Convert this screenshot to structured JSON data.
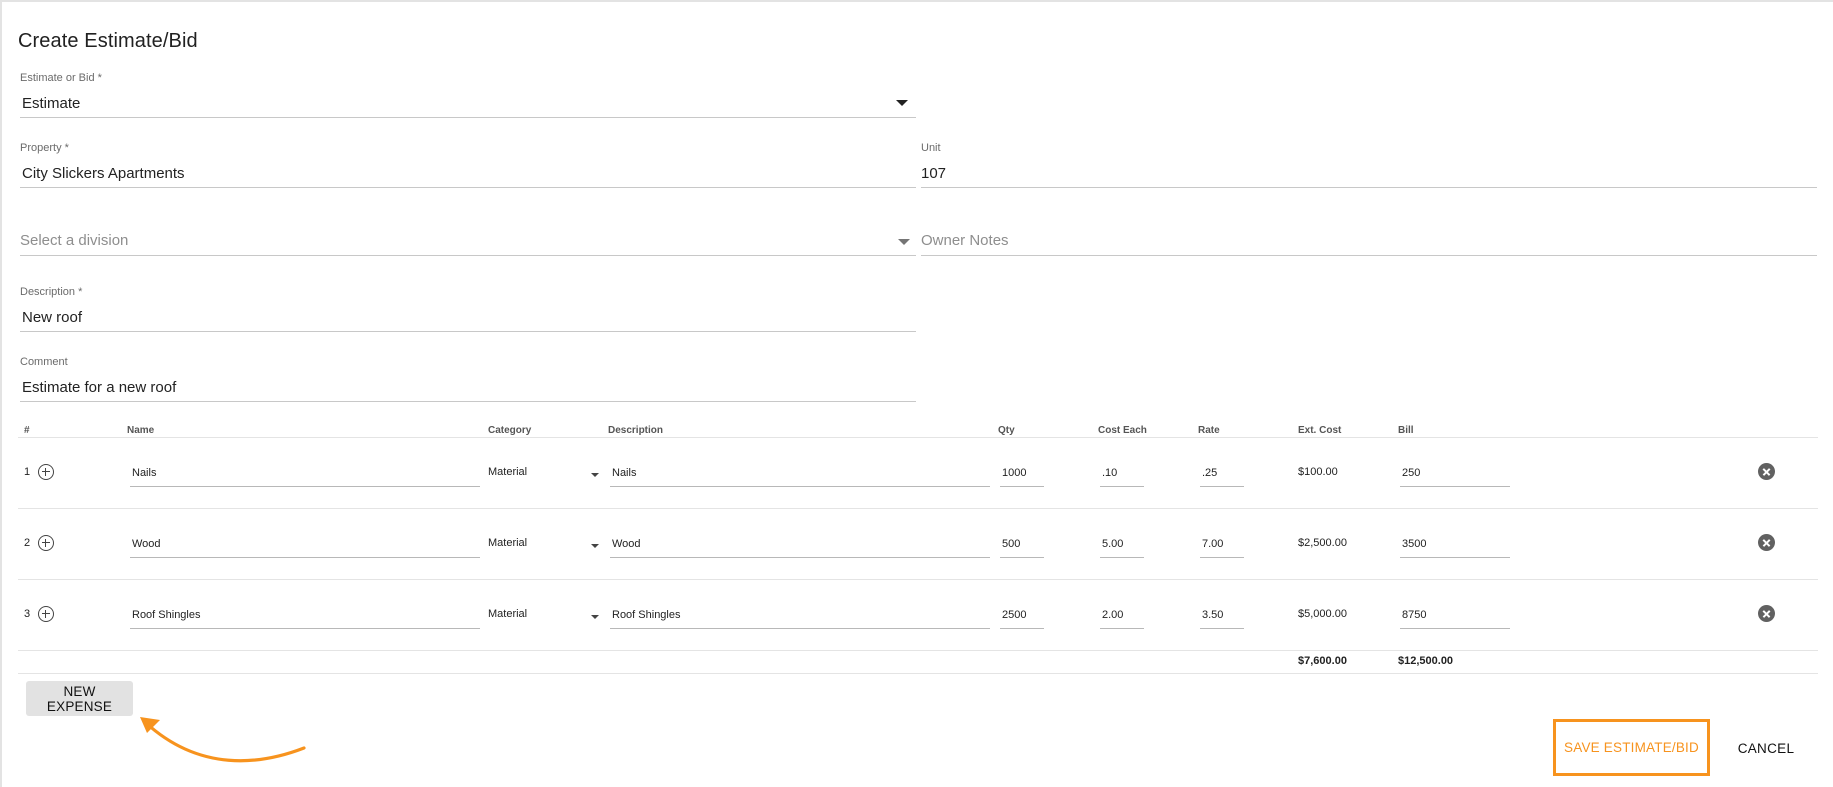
{
  "page": {
    "title": "Create Estimate/Bid"
  },
  "form": {
    "estimate_or_bid": {
      "label": "Estimate or Bid *",
      "value": "Estimate"
    },
    "property": {
      "label": "Property *",
      "value": "City Slickers Apartments"
    },
    "unit": {
      "label": "Unit",
      "value": "107"
    },
    "division": {
      "placeholder": "Select a division"
    },
    "owner_notes": {
      "placeholder": "Owner Notes"
    },
    "description": {
      "label": "Description *",
      "value": "New roof"
    },
    "comment": {
      "label": "Comment",
      "value": "Estimate for a new roof"
    }
  },
  "table": {
    "headers": {
      "num": "#",
      "name": "Name",
      "category": "Category",
      "description": "Description",
      "qty": "Qty",
      "cost_each": "Cost Each",
      "rate": "Rate",
      "ext_cost": "Ext. Cost",
      "bill": "Bill"
    },
    "rows": [
      {
        "num": "1",
        "name": "Nails",
        "category": "Material",
        "description": "Nails",
        "qty": "1000",
        "cost_each": ".10",
        "rate": ".25",
        "ext_cost": "$100.00",
        "bill": "250"
      },
      {
        "num": "2",
        "name": "Wood",
        "category": "Material",
        "description": "Wood",
        "qty": "500",
        "cost_each": "5.00",
        "rate": "7.00",
        "ext_cost": "$2,500.00",
        "bill": "3500"
      },
      {
        "num": "3",
        "name": "Roof Shingles",
        "category": "Material",
        "description": "Roof Shingles",
        "qty": "2500",
        "cost_each": "2.00",
        "rate": "3.50",
        "ext_cost": "$5,000.00",
        "bill": "8750"
      }
    ],
    "totals": {
      "ext_cost": "$7,600.00",
      "bill": "$12,500.00"
    }
  },
  "actions": {
    "new_expense": "NEW EXPENSE",
    "save": "SAVE ESTIMATE/BID",
    "cancel": "CANCEL"
  },
  "colors": {
    "accent": "#f7931e",
    "button_grey": "#e2e2e2",
    "delete_icon": "#616161"
  },
  "icons": [
    "chevron-down-icon",
    "add-circle-icon",
    "remove-circle-icon",
    "arrow-annotation"
  ]
}
